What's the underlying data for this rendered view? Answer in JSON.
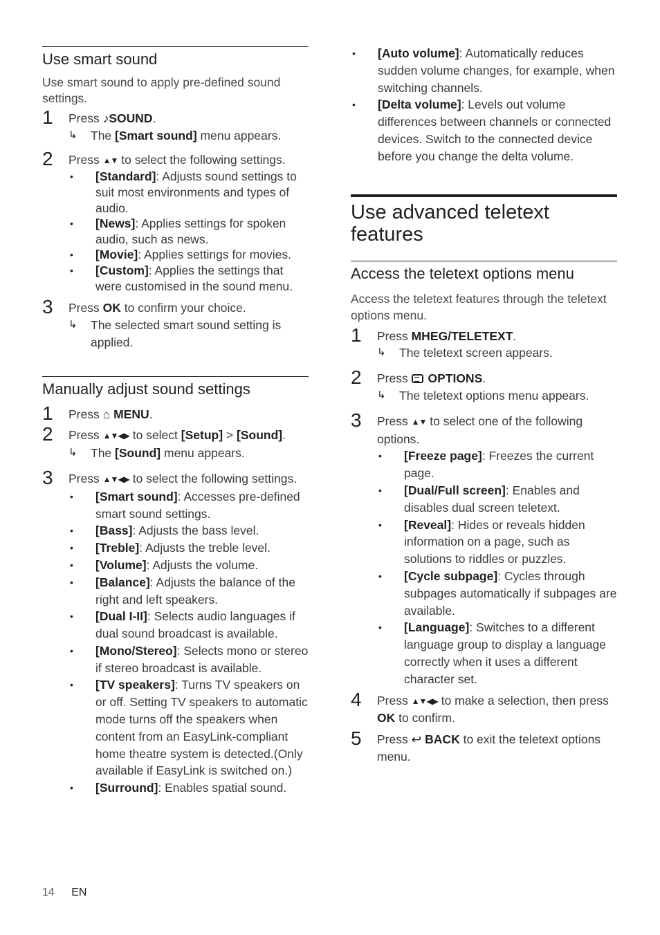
{
  "left": {
    "smart_sound": {
      "heading": "Use smart sound",
      "intro": "Use smart sound to apply pre-defined sound settings.",
      "steps": [
        {
          "num": "1",
          "pre": "Press",
          "icon": "music-note-icon",
          "icon_glyph": "♪",
          "key": "SOUND",
          "post": ".",
          "result": {
            "pre": "The",
            "term": "[Smart sound]",
            "post": "menu appears."
          }
        },
        {
          "num": "2",
          "pre": "Press",
          "arrows": "▲▼",
          "post": "to select the following settings.",
          "items": [
            {
              "term": "[Standard]",
              "desc": ": Adjusts sound settings to suit most environments and types of audio."
            },
            {
              "term": "[News]",
              "desc": ": Applies settings for spoken audio, such as news."
            },
            {
              "term": "[Movie]",
              "desc": ": Applies settings for movies."
            },
            {
              "term": "[Custom]",
              "desc": ": Applies the settings that were customised in the sound menu."
            }
          ]
        },
        {
          "num": "3",
          "pre": "Press",
          "key": "OK",
          "post": "to confirm your choice.",
          "result": {
            "text": "The selected smart sound setting is applied."
          }
        }
      ]
    },
    "manual_sound": {
      "heading": "Manually adjust sound settings",
      "steps": [
        {
          "num": "1",
          "pre": "Press",
          "icon": "home-icon",
          "icon_glyph": "⌂",
          "key": "MENU",
          "post": "."
        },
        {
          "num": "2",
          "pre": "Press",
          "arrows": "▲▼◀▶",
          "mid": "to select",
          "term1": "[Setup]",
          "sep": ">",
          "term2": "[Sound]",
          "post": ".",
          "result": {
            "pre": "The",
            "term": "[Sound]",
            "post": "menu appears."
          }
        },
        {
          "num": "3",
          "pre": "Press",
          "arrows": "▲▼◀▶",
          "post": "to select the following settings.",
          "items": [
            {
              "term": "[Smart sound]",
              "desc": ": Accesses pre-defined smart sound settings."
            },
            {
              "term": "[Bass]",
              "desc": ": Adjusts the bass level."
            },
            {
              "term": "[Treble]",
              "desc": ": Adjusts the treble level."
            },
            {
              "term": "[Volume]",
              "desc": ": Adjusts the volume."
            },
            {
              "term": "[Balance]",
              "desc": ": Adjusts the balance of the right and left speakers."
            },
            {
              "term": "[Dual I-II]",
              "desc": ": Selects audio languages if dual sound broadcast is available."
            },
            {
              "term": "[Mono/Stereo]",
              "desc": ": Selects mono or stereo if stereo broadcast is available."
            },
            {
              "term": "[TV speakers]",
              "desc": ": Turns TV speakers on or off. Setting TV speakers to automatic mode turns off the speakers when content from an EasyLink-compliant home theatre system is detected.(Only available if EasyLink is switched on.)"
            },
            {
              "term": "[Surround]",
              "desc": ": Enables spatial sound."
            }
          ]
        }
      ]
    }
  },
  "right": {
    "continued_items": [
      {
        "term": "[Auto volume]",
        "desc": ": Automatically reduces sudden volume changes, for example, when switching channels."
      },
      {
        "term": "[Delta volume]",
        "desc": ": Levels out volume differences between channels or connected devices. Switch to the connected device before you change the delta volume."
      }
    ],
    "teletext": {
      "title": "Use advanced teletext features",
      "sub_heading": "Access the teletext options menu",
      "intro": "Access the teletext features through the teletext options menu.",
      "steps": [
        {
          "num": "1",
          "pre": "Press",
          "key": "MHEG/TELETEXT",
          "post": ".",
          "result": "The teletext screen appears."
        },
        {
          "num": "2",
          "pre": "Press",
          "icon": "options-icon",
          "key": "OPTIONS",
          "post": ".",
          "result": "The teletext options menu appears."
        },
        {
          "num": "3",
          "pre": "Press",
          "arrows": "▲▼",
          "post": "to select one of the following options.",
          "items": [
            {
              "term": "[Freeze page]",
              "desc": ": Freezes the current page."
            },
            {
              "term": "[Dual/Full screen]",
              "desc": ": Enables and disables dual screen teletext."
            },
            {
              "term": "[Reveal]",
              "desc": ": Hides or reveals hidden information on a page, such as solutions to riddles or puzzles."
            },
            {
              "term": "[Cycle subpage]",
              "desc": ": Cycles through subpages automatically if subpages are available."
            },
            {
              "term": "[Language]",
              "desc": ": Switches to a different language group to display a language correctly when it uses a different character set."
            }
          ]
        },
        {
          "num": "4",
          "pre": "Press",
          "arrows": "▲▼◀▶",
          "mid": "to make a selection, then press",
          "key": "OK",
          "post": "to confirm."
        },
        {
          "num": "5",
          "pre": "Press",
          "icon": "back-icon",
          "icon_glyph": "↩",
          "key": "BACK",
          "post": "to exit the teletext options menu."
        }
      ]
    }
  },
  "footer": {
    "page_number": "14",
    "language": "EN"
  },
  "symbols": {
    "bullet": "•",
    "result_arrow": "↳"
  }
}
